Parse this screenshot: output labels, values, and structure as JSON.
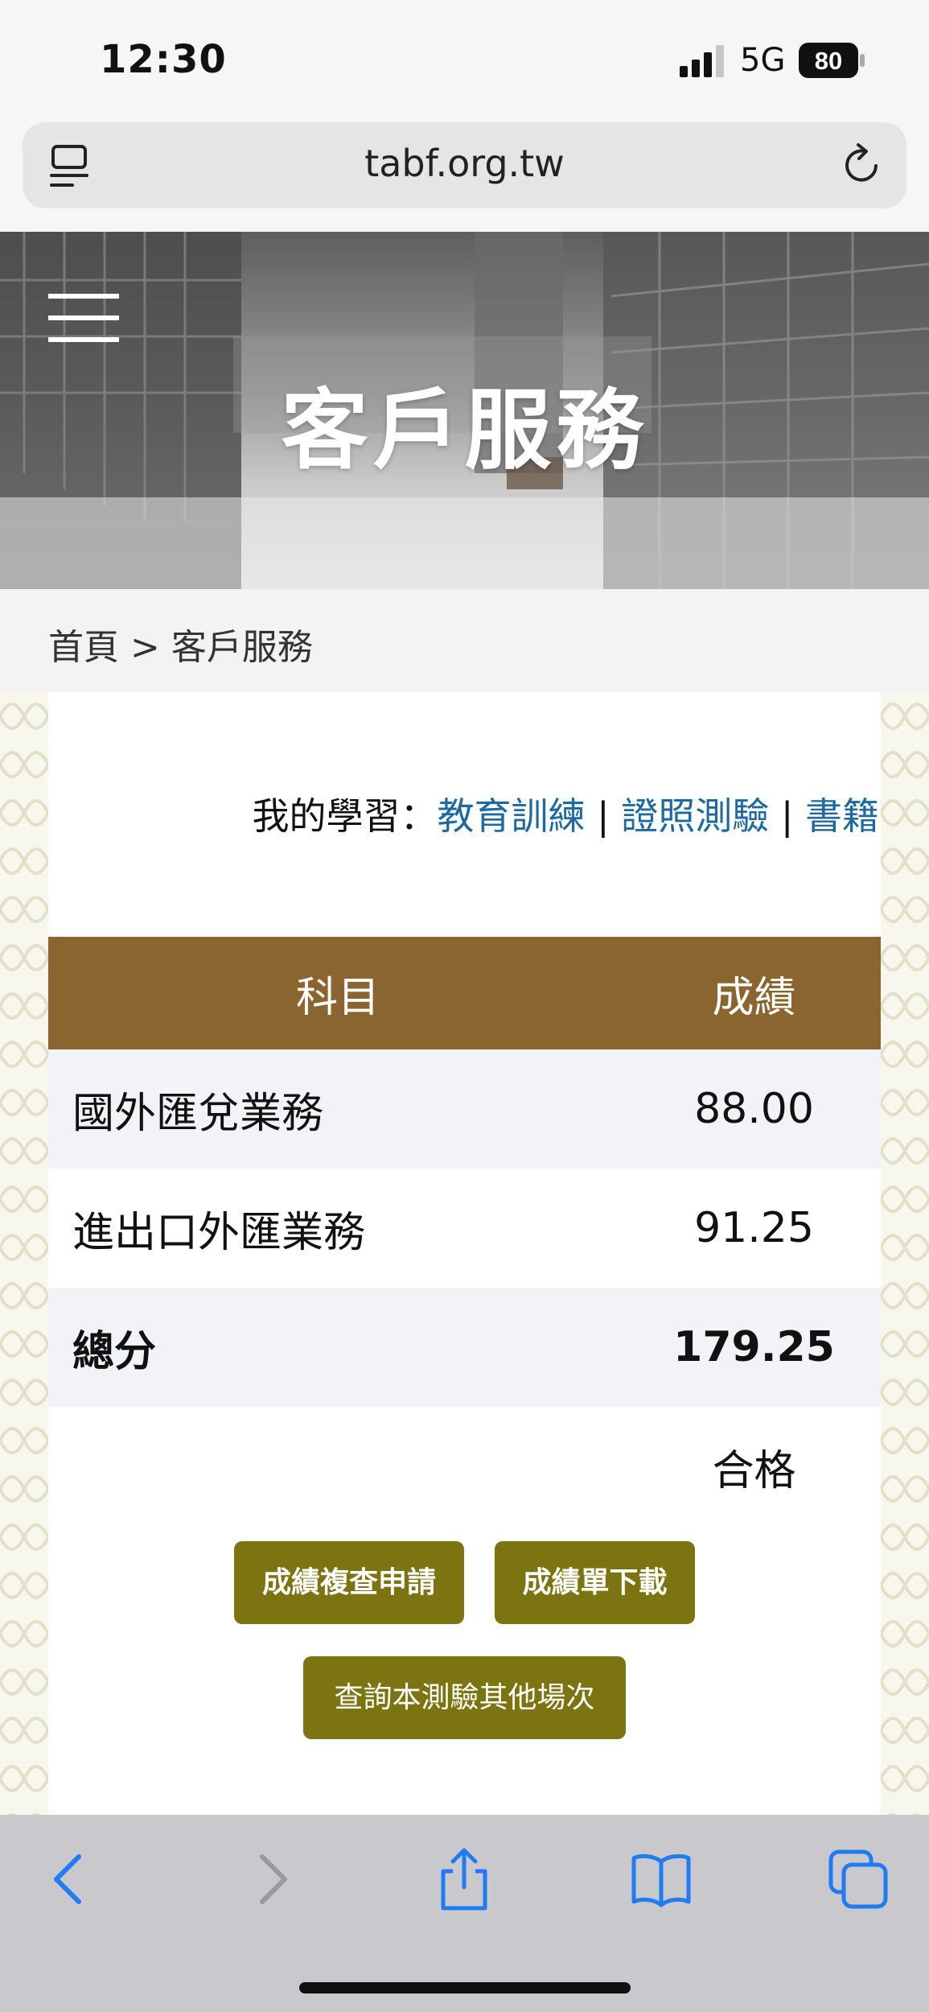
{
  "status_bar": {
    "time": "12:30",
    "network": "5G",
    "battery": "80"
  },
  "address_bar": {
    "url": "tabf.org.tw"
  },
  "hero": {
    "title": "客戶服務"
  },
  "breadcrumb": {
    "text": "首頁 > 客戶服務"
  },
  "my_learning": {
    "label": "我的學習：",
    "links": [
      "教育訓練",
      "證照測驗",
      "書籍"
    ],
    "separator": "|"
  },
  "score_table": {
    "headers": {
      "subject": "科目",
      "score": "成績"
    },
    "rows": [
      {
        "subject": "國外匯兌業務",
        "score": "88.00"
      },
      {
        "subject": "進出口外匯業務",
        "score": "91.25"
      }
    ],
    "total": {
      "label": "總分",
      "score": "179.25"
    },
    "result": "合格"
  },
  "buttons": {
    "review": "成績複查申請",
    "download": "成績單下載",
    "other_sessions": "查詢本測驗其他場次"
  },
  "colors": {
    "header_brown": "#8b6530",
    "button_olive": "#7c7410",
    "link_blue": "#1e6aa0",
    "ios_blue": "#1f7cf5"
  }
}
